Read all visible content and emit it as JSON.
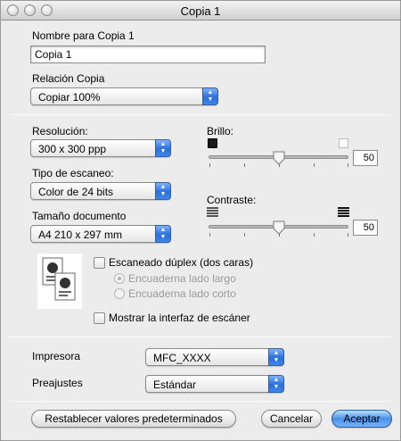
{
  "window": {
    "title": "Copia 1"
  },
  "name_section": {
    "label": "Nombre para Copia 1",
    "value": "Copia 1"
  },
  "ratio": {
    "label": "Relación Copia",
    "selected": "Copiar 100%"
  },
  "resolution": {
    "label": "Resolución:",
    "selected": "300 x 300 ppp"
  },
  "scan_type": {
    "label": "Tipo de escaneo:",
    "selected": "Color de 24 bits"
  },
  "doc_size": {
    "label": "Tamaño documento",
    "selected": "A4  210 x 297 mm"
  },
  "brightness": {
    "label": "Brillo:",
    "value": "50",
    "level_percent": 50
  },
  "contrast": {
    "label": "Contraste:",
    "value": "50",
    "level_percent": 50
  },
  "duplex": {
    "checkbox_label": "Escaneado dúplex (dos caras)",
    "checked": false,
    "option_long": "Encuaderna lado largo",
    "option_short": "Encuaderna lado corto"
  },
  "scanner_ui": {
    "checkbox_label": "Mostrar la interfaz de escáner",
    "checked": false
  },
  "printer": {
    "label": "Impresora",
    "selected": "MFC_XXXX"
  },
  "presets": {
    "label": "Preajustes",
    "selected": "Estándar"
  },
  "buttons": {
    "reset": "Restablecer valores predeterminados",
    "cancel": "Cancelar",
    "ok": "Aceptar"
  },
  "colors": {
    "accent": "#3a82e8"
  }
}
